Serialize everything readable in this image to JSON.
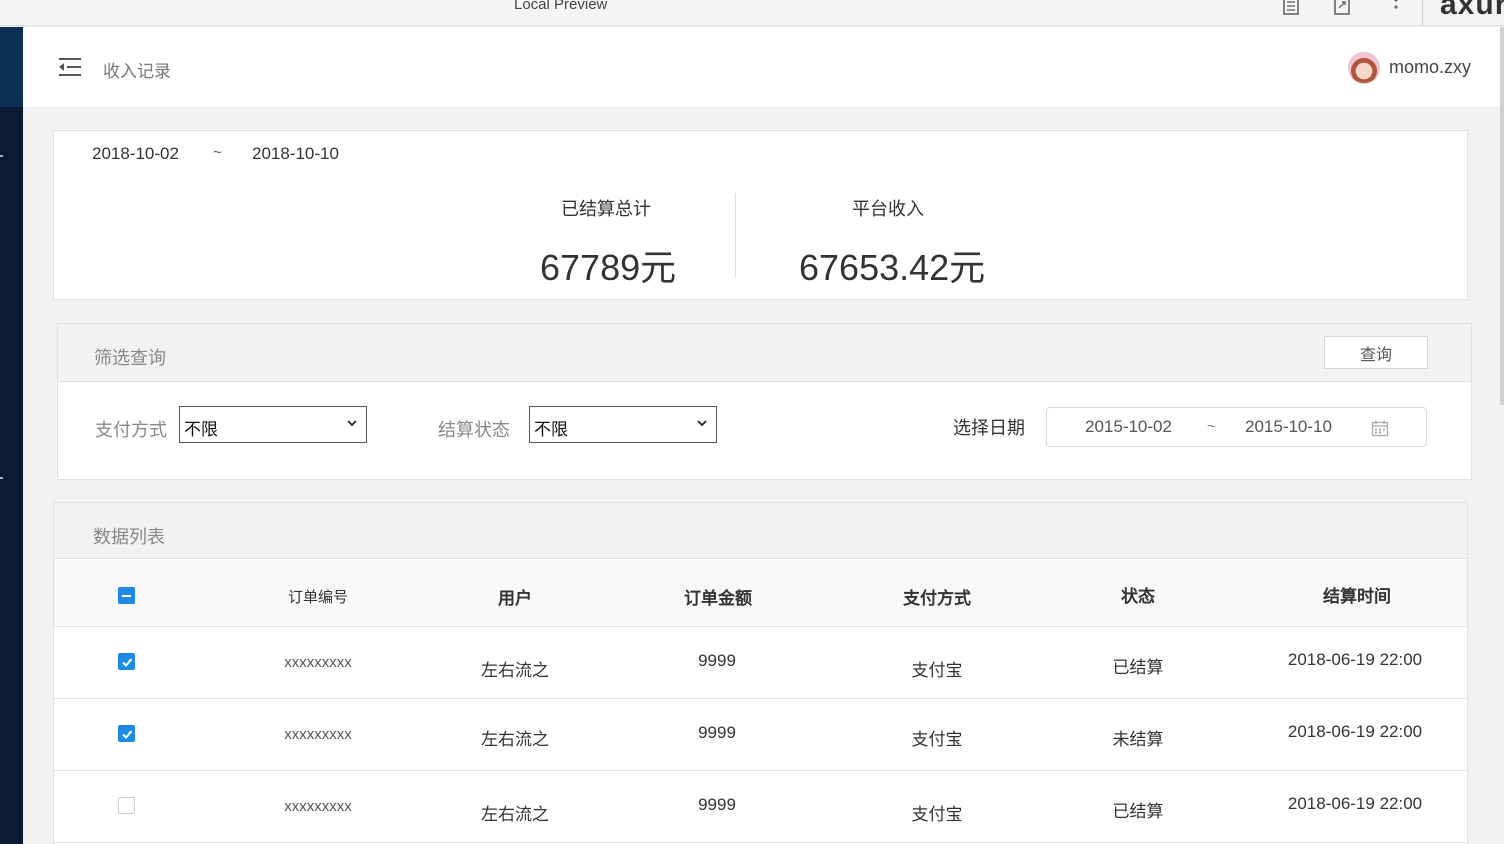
{
  "preview_bar": {
    "title": "Local Preview",
    "brand": "axure"
  },
  "header": {
    "title": "收入记录",
    "username": "momo.zxy"
  },
  "summary": {
    "range_start": "2018-10-02",
    "range_sep": "~",
    "range_end": "2018-10-10",
    "settled_label": "已结算总计",
    "settled_value": "67789元",
    "platform_label": "平台收入",
    "platform_value": "67653.42元"
  },
  "filter": {
    "title": "筛选查询",
    "query_button": "查询",
    "payment_label": "支付方式",
    "payment_value": "不限",
    "status_label": "结算状态",
    "status_value": "不限",
    "date_label": "选择日期",
    "date_start": "2015-10-02",
    "date_sep": "~",
    "date_end": "2015-10-10"
  },
  "datalist": {
    "title": "数据列表",
    "columns": [
      "订单编号",
      "用户",
      "订单金额",
      "支付方式",
      "状态",
      "结算时间"
    ],
    "rows": [
      {
        "checked": true,
        "order_no": "xxxxxxxxx",
        "user": "左右流之",
        "amount": "9999",
        "payment": "支付宝",
        "status": "已结算",
        "time": "2018-06-19 22:00"
      },
      {
        "checked": true,
        "order_no": "xxxxxxxxx",
        "user": "左右流之",
        "amount": "9999",
        "payment": "支付宝",
        "status": "未结算",
        "time": "2018-06-19 22:00"
      },
      {
        "checked": false,
        "order_no": "xxxxxxxxx",
        "user": "左右流之",
        "amount": "9999",
        "payment": "支付宝",
        "status": "已结算",
        "time": "2018-06-19 22:00"
      }
    ]
  },
  "colors": {
    "accent": "#1e88e5",
    "sidebar": "#0c1b33"
  }
}
